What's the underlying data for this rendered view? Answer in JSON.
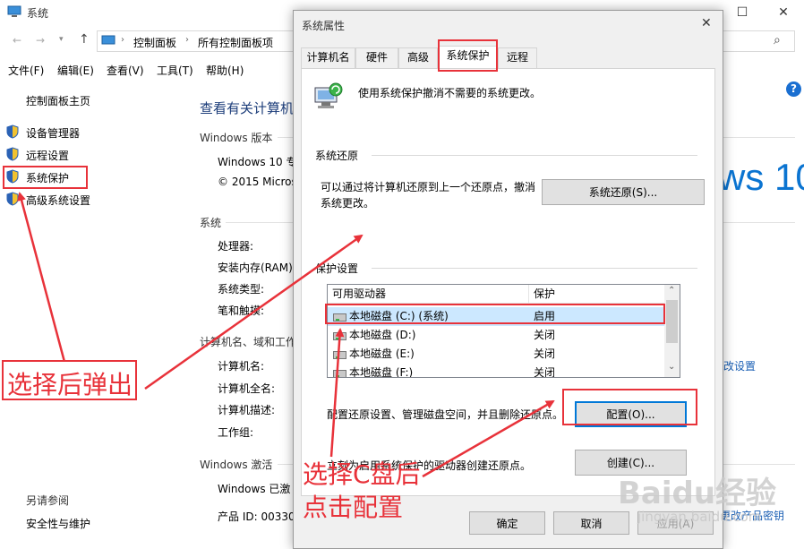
{
  "window": {
    "title": "系统",
    "breadcrumb": [
      "控制面板",
      "所有控制面板项"
    ],
    "menu": [
      "文件(F)",
      "编辑(E)",
      "查看(V)",
      "工具(T)",
      "帮助(H)"
    ]
  },
  "sidebar": {
    "home": "控制面板主页",
    "items": [
      "设备管理器",
      "远程设置",
      "系统保护",
      "高级系统设置"
    ],
    "see_also_title": "另请参阅",
    "see_also_items": [
      "安全性与维护"
    ]
  },
  "main": {
    "heading": "查看有关计算机",
    "edition_section": "Windows 版本",
    "edition_name": "Windows 10 专",
    "copyright": "© 2015 Micros",
    "logo_text": "ws 10",
    "system_section": "系统",
    "system_labels": [
      "处理器:",
      "安装内存(RAM):",
      "系统类型:",
      "笔和触摸:"
    ],
    "computer_section": "计算机名、域和工作",
    "computer_labels": [
      "计算机名:",
      "计算机全名:",
      "计算机描述:",
      "工作组:"
    ],
    "change_settings": "改设置",
    "activation_section": "Windows 激活",
    "activation_status": "Windows 已激",
    "product_id_label": "产品 ID: 00330",
    "change_key": "更改产品密钥"
  },
  "dialog": {
    "title": "系统属性",
    "tabs": [
      "计算机名",
      "硬件",
      "高级",
      "系统保护",
      "远程"
    ],
    "intro": "使用系统保护撤消不需要的系统更改。",
    "restore_group": "系统还原",
    "restore_desc": "可以通过将计算机还原到上一个还原点，撤消系统更改。",
    "restore_desc_line1": "可以通过将计算机还原到上一个还原点，撤消",
    "restore_desc_line2": "系统更改。",
    "restore_button": "系统还原(S)...",
    "protection_group": "保护设置",
    "list_headers": [
      "可用驱动器",
      "保护"
    ],
    "drives": [
      {
        "name": "本地磁盘 (C:) (系统)",
        "status": "启用"
      },
      {
        "name": "本地磁盘 (D:)",
        "status": "关闭"
      },
      {
        "name": "本地磁盘 (E:)",
        "status": "关闭"
      },
      {
        "name": "本地磁盘 (F:)",
        "status": "关闭"
      }
    ],
    "configure_desc": "配置还原设置、管理磁盘空间，并且删除还原点。",
    "configure_button": "配置(O)...",
    "create_desc": "立刻为启用系统保护的驱动器创建还原点。",
    "create_button": "创建(C)...",
    "ok_button": "确定",
    "cancel_button": "取消",
    "apply_button": "应用(A)"
  },
  "annotations": {
    "popup_note": "选择后弹出",
    "select_line1": "选择C盘后",
    "select_line2": "点击配置",
    "color": "#e8323a"
  },
  "watermark": {
    "brand": "Baidu经验",
    "url": "jingyan.baidu.com"
  }
}
